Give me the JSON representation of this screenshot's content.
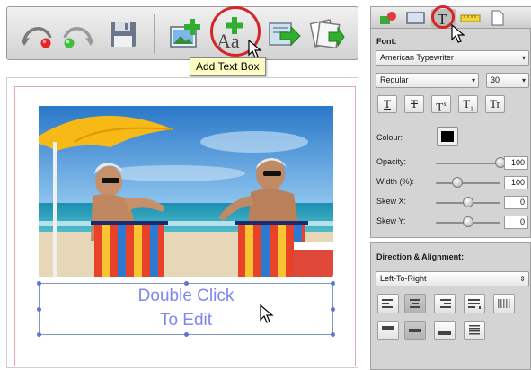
{
  "toolbar": {
    "buttons": [
      {
        "name": "undo",
        "icon": "undo-arrow-icon"
      },
      {
        "name": "redo",
        "icon": "redo-arrow-icon"
      },
      {
        "name": "save",
        "icon": "floppy-disk-icon"
      },
      {
        "name": "add-image",
        "icon": "add-image-icon"
      },
      {
        "name": "add-text-box",
        "icon": "add-text-box-icon",
        "glyph": "Aa"
      },
      {
        "name": "import",
        "icon": "import-arrow-icon"
      },
      {
        "name": "export",
        "icon": "export-arrow-icon"
      }
    ],
    "tooltip": "Add Text Box",
    "highlight_color": "#d52626"
  },
  "canvas": {
    "textbox": {
      "line1": "Double Click",
      "line2": "To Edit",
      "text_color": "#7e86f0"
    }
  },
  "inspector": {
    "tabs": [
      "shape-tab",
      "frame-tab",
      "text-tab",
      "ruler-tab",
      "document-tab"
    ],
    "selected_tab": "text-tab",
    "font_label": "Font:",
    "font_family": "American Typewriter",
    "font_style": "Regular",
    "font_size": "30",
    "format_buttons": [
      "T",
      "T",
      "T",
      "T",
      "Tr"
    ],
    "colour_label": "Colour:",
    "colour_value": "#000000",
    "opacity": {
      "label": "Opacity:",
      "value": "100",
      "level": 1.0
    },
    "width": {
      "label": "Width (%):",
      "value": "100",
      "level": 0.33
    },
    "skew_x": {
      "label": "Skew X:",
      "value": "0",
      "level": 0.5
    },
    "skew_y": {
      "label": "Skew Y:",
      "value": "0",
      "level": 0.5
    }
  },
  "direction": {
    "title": "Direction & Alignment:",
    "mode": "Left-To-Right",
    "selected_alignment": "align-center"
  }
}
